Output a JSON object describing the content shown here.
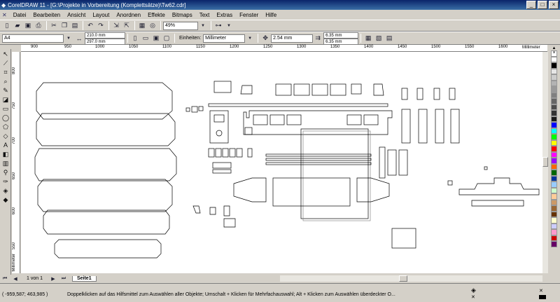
{
  "window": {
    "title": "CorelDRAW 11 - [G:\\Projekte in Vorbereitung (Komplettsätze)\\Tw62.cdr]",
    "controls": [
      "_",
      "□",
      "×"
    ]
  },
  "menu": {
    "items": [
      "Datei",
      "Bearbeiten",
      "Ansicht",
      "Layout",
      "Anordnen",
      "Effekte",
      "Bitmaps",
      "Text",
      "Extras",
      "Fenster",
      "Hilfe"
    ]
  },
  "toolbar1": {
    "zoom_value": "49%"
  },
  "toolbar2": {
    "page_size": "A4",
    "width": "210.0 mm",
    "height": "297.0 mm",
    "units_label": "Einheiten:",
    "units_value": "Millimeter",
    "nudge": "2.54 mm",
    "dup_x": "6.35 mm",
    "dup_y": "6.35 mm"
  },
  "rulers": {
    "top_labels": [
      "900",
      "950",
      "1000",
      "1050",
      "1100",
      "1150",
      "1200",
      "1250",
      "1300",
      "1350",
      "1400",
      "1450",
      "1500",
      "1550",
      "1600"
    ],
    "unit": "Millimeter",
    "left_labels": [
      "800",
      "750",
      "700",
      "650",
      "600",
      "550"
    ],
    "left_unit": "Millimeter"
  },
  "page_nav": {
    "counter": "1 von 1",
    "tab": "Seite1"
  },
  "status": {
    "coords": "( -959,587; 463,985 )",
    "hint": "Doppelklicken auf das Hilfsmittel zum Auswählen aller Objekte; Umschalt + Klicken für Mehrfachauswahl; Alt + Klicken zum Auswählen überdeckter O..."
  },
  "palette_colors": [
    "#ffffff",
    "#000000",
    "#e6e6e6",
    "#cccccc",
    "#b3b3b3",
    "#999999",
    "#808080",
    "#666666",
    "#4d4d4d",
    "#333333",
    "#1a1a1a",
    "#0000ff",
    "#00ffff",
    "#00ff00",
    "#ffff00",
    "#ff0000",
    "#ff00ff",
    "#9900ff",
    "#ff6600",
    "#006600",
    "#003399",
    "#99ccff",
    "#ccffcc",
    "#ffcc99",
    "#cc9966",
    "#996633",
    "#663300",
    "#ffffcc",
    "#ccccff",
    "#ff99cc",
    "#cc0000",
    "#660066"
  ]
}
